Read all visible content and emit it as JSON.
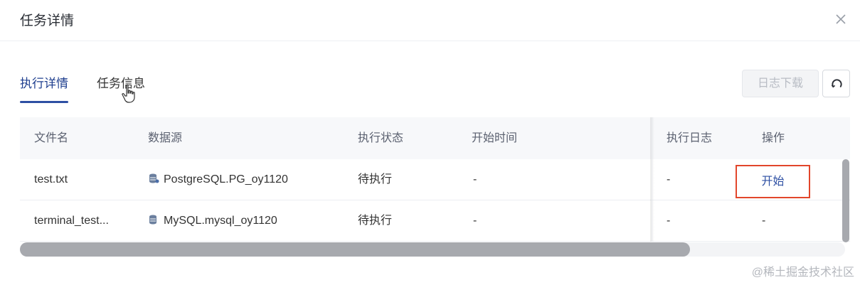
{
  "modal": {
    "title": "任务详情"
  },
  "tabs": [
    {
      "label": "执行详情",
      "active": true
    },
    {
      "label": "任务信息",
      "active": false
    }
  ],
  "toolbar": {
    "download_label": "日志下载",
    "download_disabled": true
  },
  "table": {
    "columns": [
      "文件名",
      "数据源",
      "执行状态",
      "开始时间",
      "执行日志",
      "操作"
    ],
    "rows": [
      {
        "file_name": "test.txt",
        "datasource_icon": "postgresql-icon",
        "datasource": "PostgreSQL.PG_oy1120",
        "status": "待执行",
        "start_time": "-",
        "log": "-",
        "action": "开始"
      },
      {
        "file_name": "terminal_test...",
        "datasource_icon": "mysql-icon",
        "datasource": "MySQL.mysql_oy1120",
        "status": "待执行",
        "start_time": "-",
        "log": "-",
        "action": "-"
      }
    ]
  },
  "colors": {
    "accent": "#2d4fa3",
    "highlight": "#e2462b",
    "header_bg": "#f7f8fa"
  },
  "watermark": "@稀土掘金技术社区"
}
